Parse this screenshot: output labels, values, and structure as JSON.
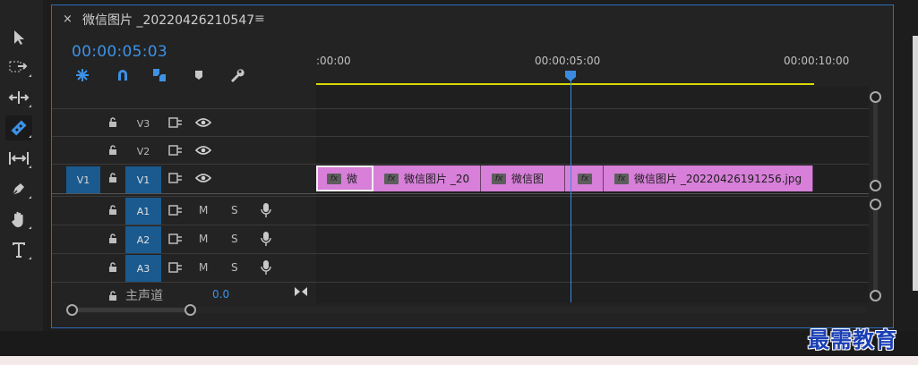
{
  "tab": {
    "close": "×",
    "title": "微信图片 _20220426210547",
    "menu": "≡"
  },
  "timecode": "00:00:05:03",
  "ruler": {
    "ticks": [
      ":00:00",
      "00:00:05:00",
      "00:00:10:00"
    ]
  },
  "tools": [
    "selection-tool",
    "track-select-tool",
    "ripple-edit-tool",
    "razor-tool",
    "slip-tool",
    "pen-tool",
    "hand-tool",
    "type-tool"
  ],
  "header_icons": [
    "snap-icon",
    "linked-selection-icon",
    "add-marker-icon",
    "marker-icon",
    "wrench-icon"
  ],
  "video_tracks": [
    {
      "name": "V3",
      "source": "",
      "targeted": false
    },
    {
      "name": "V2",
      "source": "",
      "targeted": false
    },
    {
      "name": "V1",
      "source": "V1",
      "targeted": true
    }
  ],
  "audio_tracks": [
    {
      "name": "A1",
      "m": "M",
      "s": "S"
    },
    {
      "name": "A2",
      "m": "M",
      "s": "S"
    },
    {
      "name": "A3",
      "m": "M",
      "s": "S"
    }
  ],
  "master": {
    "label": "主声道",
    "value": "0.0"
  },
  "clips": [
    {
      "fx": "fx",
      "label": "微"
    },
    {
      "fx": "fx",
      "label": "微信图片 _20"
    },
    {
      "fx": "fx",
      "label": "微信图"
    },
    {
      "fx": "fx",
      "label": ""
    },
    {
      "fx": "fx",
      "label": "微信图片 _20220426191256.jpg"
    }
  ],
  "watermark": "最需教育",
  "colors": {
    "accent": "#3d92e6",
    "clip": "#d77fd9",
    "track_target": "#1a5a8f",
    "workbar": "#d8d800"
  }
}
